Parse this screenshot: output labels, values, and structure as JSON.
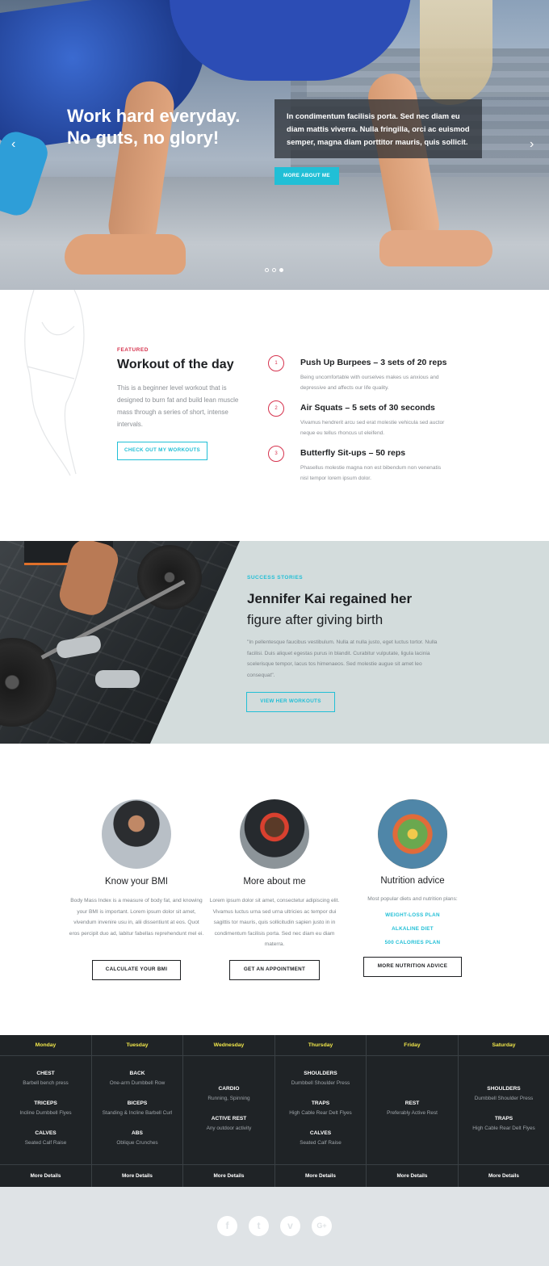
{
  "hero": {
    "title_line1": "Work hard everyday.",
    "title_line2": "No guts, no glory!",
    "quote": "In condimentum facilisis porta. Sed nec diam eu diam mattis viverra. Nulla fringilla, orci ac euismod semper, magna diam porttitor mauris, quis sollicit.",
    "button": "MORE ABOUT ME",
    "arrow_left": "‹",
    "arrow_right": "›",
    "slides": 3,
    "active_slide": 3
  },
  "workout": {
    "label": "FEATURED",
    "title": "Workout of the day",
    "description": "This is a beginner level workout that is designed to burn fat and build lean muscle mass through a series of short, intense intervals.",
    "button": "CHECK OUT MY WORKOUTS",
    "exercises": [
      {
        "num": "1",
        "title": "Push Up Burpees – 3 sets of 20 reps",
        "text": "Being uncomfortable with ourselves makes us anxious and depressive and affects our life quality."
      },
      {
        "num": "2",
        "title": "Air Squats – 5 sets of 30 seconds",
        "text": "Vivamus hendrerit arcu sed erat molestie vehicula sed auctor neque eu tellus rhoncus ut eleifend."
      },
      {
        "num": "3",
        "title": "Butterfly Sit-ups – 50 reps",
        "text": "Phasellus molestie magna non est bibendum non venenatis nisl tempor lorem ipsum dolor."
      }
    ]
  },
  "story": {
    "label": "SUCCESS STORIES",
    "title_bold": "Jennifer Kai regained her",
    "title_normal": "figure after giving birth",
    "quote": "\"In pellentesque faucibus vestibulum. Nulla at nulla justo, eget luctus tortor. Nulla facilisi. Duis aliquet egestas purus in blandit. Curabitur vulputate, ligula lacinia scelerisque tempor, lacus tos himenaeos. Sed molestie augue sit amet leo consequat\".",
    "button": "VIEW HER WORKOUTS"
  },
  "features": [
    {
      "title": "Know your BMI",
      "text": "Body Mass Index is a measure of body fat, and knowing your BMI is important. Lorem ipsum dolor sit amet, vivendum invenire usu in, alii dissentiunt at eos. Quot eros percipit duo ad, labitur fabellas reprehendunt mel ei.",
      "button": "CALCULATE YOUR BMI"
    },
    {
      "title": "More about me",
      "text": "Lorem ipsum dolor sit amet, consectetur adipiscing elit. Vivamus luctus urna sed urna ultricies ac tempor dui sagittis tor mauris, quis sollicitudin sapien justo in in condimentum facilisis porta. Sed nec diam eu diam materra.",
      "button": "GET AN APPOINTMENT"
    },
    {
      "title": "Nutrition advice",
      "text": "Most popular diets and nutrition plans:",
      "links": [
        "WEIGHT-LOSS PLAN",
        "ALKALINE DIET",
        "500 CALORIES PLAN"
      ],
      "button": "MORE NUTRITION ADVICE"
    }
  ],
  "schedule": {
    "footer_label": "More Details",
    "days": [
      {
        "name": "Monday",
        "entries": [
          {
            "a": "CHEST",
            "b": "Barbell bench press"
          },
          {
            "a": "TRICEPS",
            "b": "Incline Dumbbell Flyes"
          },
          {
            "a": "CALVES",
            "b": "Seated Calf Raise"
          }
        ]
      },
      {
        "name": "Tuesday",
        "entries": [
          {
            "a": "BACK",
            "b": "One-arm Dumbbell Row"
          },
          {
            "a": "BICEPS",
            "b": "Standing & Incline Barbell Curl"
          },
          {
            "a": "ABS",
            "b": "Oblique Crunches"
          }
        ]
      },
      {
        "name": "Wednesday",
        "entries": [
          {
            "a": "CARDIO",
            "b": "Running, Spinning"
          },
          {
            "a": "ACTIVE REST",
            "b": "Any outdoor activity"
          }
        ]
      },
      {
        "name": "Thursday",
        "entries": [
          {
            "a": "SHOULDERS",
            "b": "Dumbbell Shoulder Press"
          },
          {
            "a": "TRAPS",
            "b": "High Cable Rear Delt Flyes"
          },
          {
            "a": "CALVES",
            "b": "Seated Calf Raise"
          }
        ]
      },
      {
        "name": "Friday",
        "entries": [
          {
            "a": "REST",
            "b": "Preferably Active Rest"
          }
        ]
      },
      {
        "name": "Saturday",
        "entries": [
          {
            "a": "SHOULDERS",
            "b": "Dumbbell Shoulder Press"
          },
          {
            "a": "TRAPS",
            "b": "High Cable Rear Delt Flyes"
          }
        ]
      }
    ]
  },
  "footer": {
    "social": [
      {
        "icon": "facebook-icon",
        "glyph": "f"
      },
      {
        "icon": "twitter-icon",
        "glyph": "t"
      },
      {
        "icon": "vimeo-icon",
        "glyph": "v"
      },
      {
        "icon": "google-plus-icon",
        "glyph": "G+"
      }
    ]
  },
  "colors": {
    "accent": "#21bfd6",
    "red": "#d6334e",
    "schedule_bg": "#1f2326",
    "day_name": "#f0e64a"
  }
}
